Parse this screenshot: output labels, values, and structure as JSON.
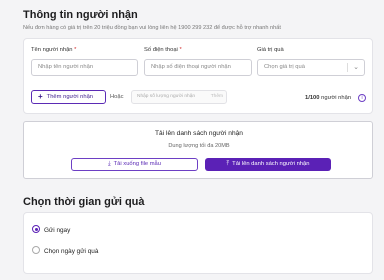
{
  "recipient_section": {
    "title": "Thông tin người nhận",
    "hint": "Nếu đơn hàng có giá trị trên 20 triệu đồng bạn vui lòng liên hệ 1900 299 232 để được hỗ trợ nhanh nhất"
  },
  "form": {
    "name_label": "Tên người nhận",
    "name_placeholder": "Nhập tên người nhận",
    "phone_label": "Số điện thoại",
    "phone_placeholder": "Nhập số điện thoại người nhận",
    "gift_label": "Giá trị quà",
    "gift_placeholder": "Chọn giá trị quà",
    "required_mark": "*"
  },
  "add_row": {
    "add_button": "Thêm người nhận",
    "or_text": "Hoặc",
    "quantity_placeholder": "Nhập số lượng người nhận",
    "quantity_action": "Thêm",
    "count_current": "1/100",
    "count_suffix": "người nhận",
    "info_icon": "i"
  },
  "upload": {
    "title": "Tải lên danh sách người nhận",
    "subtitle": "Dung lượng tối đa 20MB",
    "download_button": "Tải xuống file mẫu",
    "upload_button": "Tải lên danh sách người nhận"
  },
  "delivery_section": {
    "title": "Chọn thời gian gửi quà",
    "options": [
      {
        "label": "Gửi ngay",
        "selected": true
      },
      {
        "label": "Chọn ngày gửi quà",
        "selected": false
      }
    ]
  },
  "colors": {
    "accent": "#5b21b6",
    "required": "#d32f2f"
  }
}
